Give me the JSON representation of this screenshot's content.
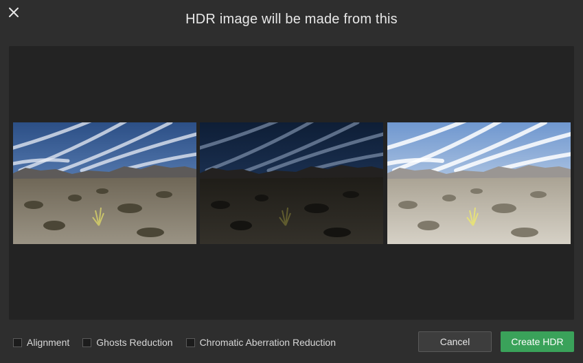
{
  "dialog": {
    "title": "HDR image will be made from this",
    "close_icon": "close-icon"
  },
  "thumbnails": [
    {
      "exposure": "normal"
    },
    {
      "exposure": "under"
    },
    {
      "exposure": "over"
    }
  ],
  "options": [
    {
      "label": "Alignment",
      "checked": false
    },
    {
      "label": "Ghosts Reduction",
      "checked": false
    },
    {
      "label": "Chromatic Aberration Reduction",
      "checked": false
    }
  ],
  "buttons": {
    "cancel_label": "Cancel",
    "create_label": "Create HDR"
  },
  "colors": {
    "background": "#2e2e2e",
    "panel": "#232323",
    "accent": "#3aa25a"
  }
}
